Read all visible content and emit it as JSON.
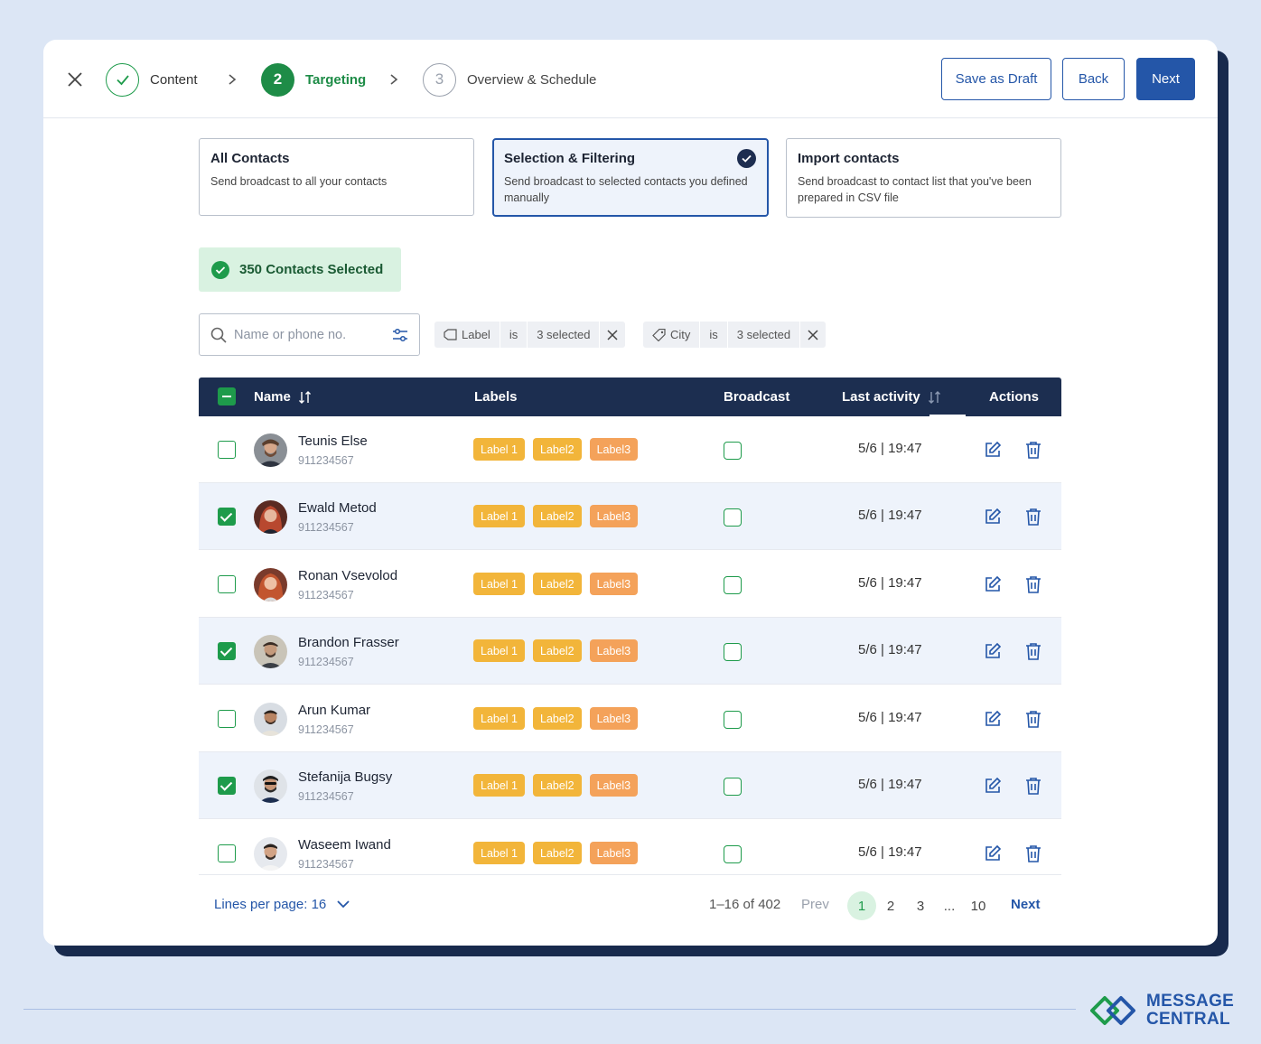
{
  "wizard": {
    "steps": [
      {
        "number": "",
        "label": "Content",
        "state": "done"
      },
      {
        "number": "2",
        "label": "Targeting",
        "state": "active"
      },
      {
        "number": "3",
        "label": "Overview & Schedule",
        "state": "todo"
      }
    ],
    "buttons": {
      "save_draft": "Save as Draft",
      "back": "Back",
      "next": "Next"
    }
  },
  "audience_options": [
    {
      "title": "All Contacts",
      "description": "Send broadcast to all your contacts",
      "selected": false
    },
    {
      "title": "Selection & Filtering",
      "description": "Send broadcast to selected contacts you defined manually",
      "selected": true
    },
    {
      "title": "Import contacts",
      "description": "Send broadcast to contact list that you've been prepared in CSV file",
      "selected": false
    }
  ],
  "selected_count_text": "350 Contacts Selected",
  "search": {
    "placeholder": "Name or phone no.",
    "value": ""
  },
  "filters": [
    {
      "field": "Label",
      "operator": "is",
      "value": "3 selected",
      "icon": "label-tag-icon"
    },
    {
      "field": "City",
      "operator": "is",
      "value": "3 selected",
      "icon": "price-tag-icon"
    }
  ],
  "table": {
    "columns": [
      "Name",
      "Labels",
      "Broadcast",
      "Last activity",
      "Actions"
    ],
    "rows": [
      {
        "name": "Teunis Else",
        "phone": "911234567",
        "labels": [
          "Label 1",
          "Label2",
          "Label3"
        ],
        "checked": false,
        "broadcast": false,
        "last_activity": "5/6 | 19:47"
      },
      {
        "name": "Ewald Metod",
        "phone": "911234567",
        "labels": [
          "Label 1",
          "Label2",
          "Label3"
        ],
        "checked": true,
        "broadcast": false,
        "last_activity": "5/6 | 19:47"
      },
      {
        "name": "Ronan Vsevolod",
        "phone": "911234567",
        "labels": [
          "Label 1",
          "Label2",
          "Label3"
        ],
        "checked": false,
        "broadcast": false,
        "last_activity": "5/6 | 19:47"
      },
      {
        "name": "Brandon Frasser",
        "phone": "911234567",
        "labels": [
          "Label 1",
          "Label2",
          "Label3"
        ],
        "checked": true,
        "broadcast": false,
        "last_activity": "5/6 | 19:47"
      },
      {
        "name": "Arun Kumar",
        "phone": "911234567",
        "labels": [
          "Label 1",
          "Label2",
          "Label3"
        ],
        "checked": false,
        "broadcast": false,
        "last_activity": "5/6 | 19:47"
      },
      {
        "name": "Stefanija Bugsy",
        "phone": "911234567",
        "labels": [
          "Label 1",
          "Label2",
          "Label3"
        ],
        "checked": true,
        "broadcast": false,
        "last_activity": "5/6 | 19:47"
      },
      {
        "name": "Waseem Iwand",
        "phone": "911234567",
        "labels": [
          "Label 1",
          "Label2",
          "Label3"
        ],
        "checked": false,
        "broadcast": false,
        "last_activity": "5/6 | 19:47"
      }
    ]
  },
  "pagination": {
    "lines_per_page": "Lines per page: 16",
    "range": "1–16 of 402",
    "prev": "Prev",
    "pages": [
      "1",
      "2",
      "3",
      "...",
      "10"
    ],
    "current": "1",
    "next": "Next"
  },
  "brand": {
    "line1": "MESSAGE",
    "line2": "CENTRAL"
  },
  "colors": {
    "primary": "#2456a8",
    "success": "#1e9b4b",
    "header_navy": "#1c2e50",
    "label_yellow": "#f2b53a",
    "label_orange": "#f4a25a"
  }
}
